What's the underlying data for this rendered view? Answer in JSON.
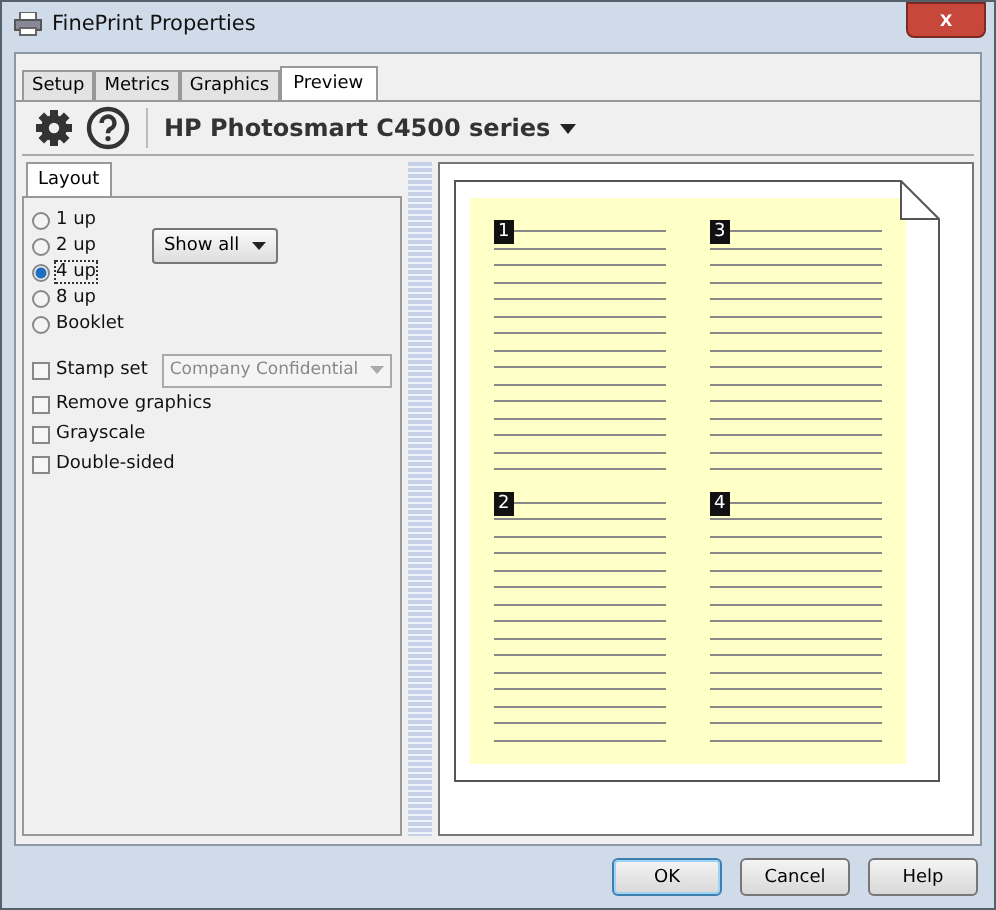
{
  "window": {
    "title": "FinePrint Properties",
    "close": "x"
  },
  "tabs": [
    {
      "label": "Setup",
      "selected": false
    },
    {
      "label": "Metrics",
      "selected": false
    },
    {
      "label": "Graphics",
      "selected": false
    },
    {
      "label": "Preview",
      "selected": true
    }
  ],
  "toolbar": {
    "printer": "HP Photosmart C4500 series"
  },
  "layout_tab": "Layout",
  "layouts": [
    {
      "label": "1 up",
      "selected": false
    },
    {
      "label": "2 up",
      "selected": false
    },
    {
      "label": "4 up",
      "selected": true
    },
    {
      "label": "8 up",
      "selected": false
    },
    {
      "label": "Booklet",
      "selected": false
    }
  ],
  "show_all": "Show all",
  "stamp": {
    "label": "Stamp set",
    "checked": false,
    "value": "Company Confidential"
  },
  "options": [
    {
      "label": "Remove graphics",
      "checked": false
    },
    {
      "label": "Grayscale",
      "checked": false
    },
    {
      "label": "Double-sided",
      "checked": false
    }
  ],
  "preview_pages": [
    "1",
    "3",
    "2",
    "4"
  ],
  "buttons": [
    {
      "label": "OK",
      "default": true
    },
    {
      "label": "Cancel",
      "default": false
    },
    {
      "label": "Help",
      "default": false
    }
  ]
}
